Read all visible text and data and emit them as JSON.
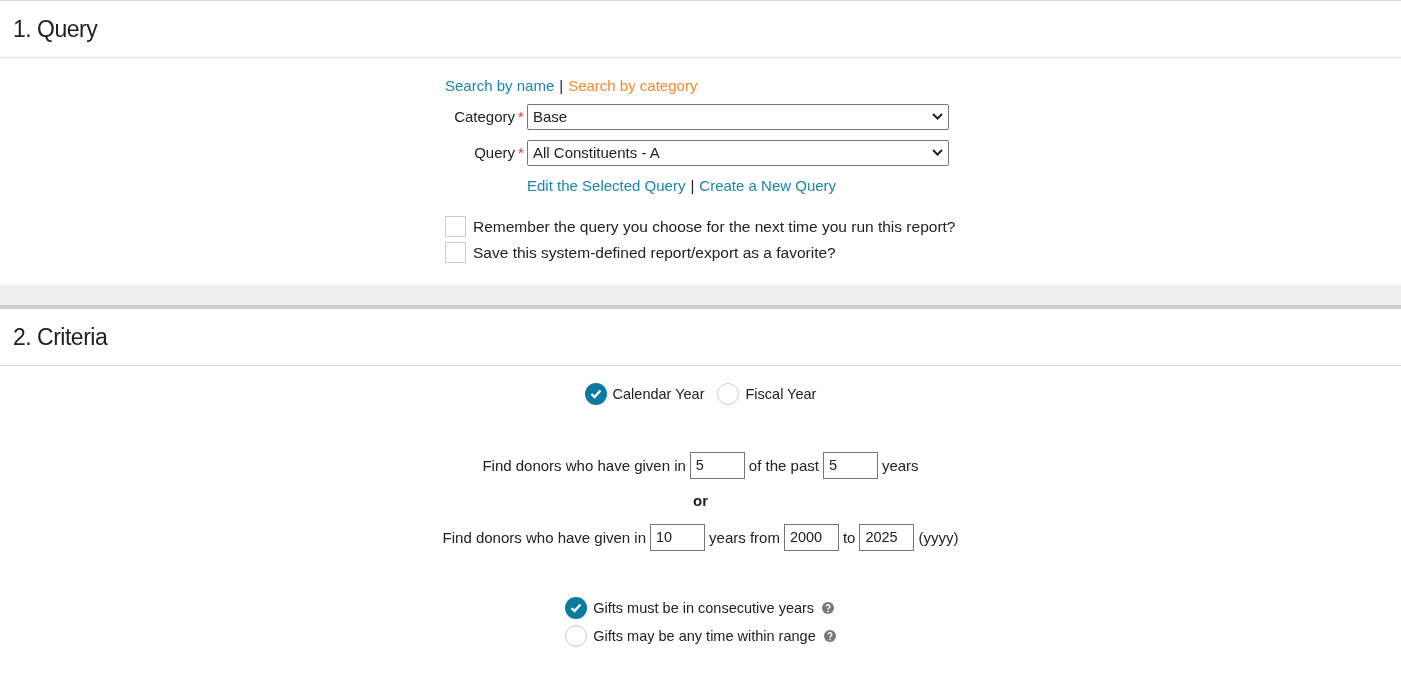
{
  "sections": [
    {
      "title": "1. Query"
    },
    {
      "title": "2. Criteria"
    }
  ],
  "query": {
    "link_separator": "|",
    "required_marker": "*",
    "search_links": [
      {
        "label": "Search by name",
        "selected": false
      },
      {
        "label": "Search by category",
        "selected": true
      }
    ],
    "fields": [
      {
        "label": "Category",
        "required": true,
        "value": "Base"
      },
      {
        "label": "Query",
        "required": true,
        "value": "All Constituents - A"
      }
    ],
    "query_links": [
      "Edit the Selected Query",
      "Create a New Query"
    ],
    "options": [
      {
        "label": "Remember the query you choose for the next time you run this report?",
        "checked": false
      },
      {
        "label": "Save this system-defined report/export as a favorite?",
        "checked": false
      }
    ]
  },
  "criteria": {
    "year_type": [
      {
        "label": "Calendar Year",
        "selected": true
      },
      {
        "label": "Fiscal Year",
        "selected": false
      }
    ],
    "rules": [
      {
        "kind": "sentence",
        "parts": [
          {
            "kind": "text",
            "text": "Find donors who have given in"
          },
          {
            "kind": "input",
            "value": "5"
          },
          {
            "kind": "text",
            "text": "of the past"
          },
          {
            "kind": "input",
            "value": "5"
          },
          {
            "kind": "text",
            "text": "years"
          }
        ]
      },
      {
        "kind": "separator",
        "text": "or"
      },
      {
        "kind": "sentence",
        "parts": [
          {
            "kind": "text",
            "text": "Find donors who have given in"
          },
          {
            "kind": "input",
            "value": "10"
          },
          {
            "kind": "text",
            "text": "years from"
          },
          {
            "kind": "input",
            "value": "2000"
          },
          {
            "kind": "text",
            "text": "to"
          },
          {
            "kind": "input",
            "value": "2025"
          },
          {
            "kind": "text",
            "text": "(yyyy)"
          }
        ]
      }
    ],
    "gift_timing": [
      {
        "label": "Gifts must be in consecutive years",
        "selected": true
      },
      {
        "label": "Gifts may be any time within range",
        "selected": false
      }
    ]
  }
}
